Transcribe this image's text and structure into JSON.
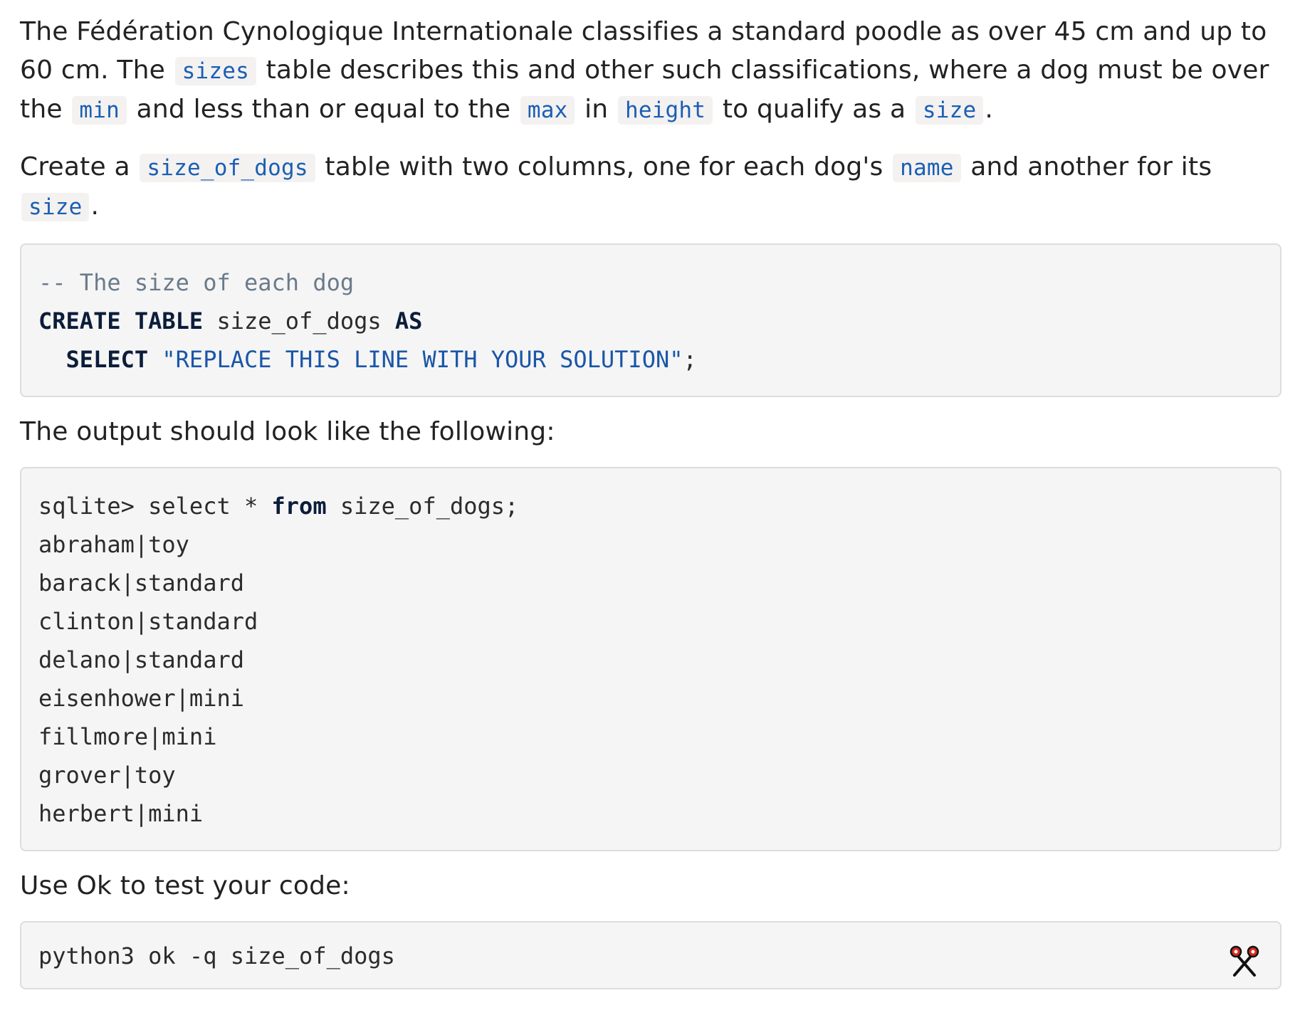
{
  "intro": {
    "t1": "The Fédération Cynologique Internationale classifies a standard poodle as over 45 cm and up to 60 cm. The",
    "c1": "sizes",
    "t2": "table describes this and other such classifications, where a dog must be over the",
    "c2": "min",
    "t3": "and less than or equal to the",
    "c3": "max",
    "t4": "in",
    "c4": "height",
    "t5": "to qualify as a",
    "c5": "size",
    "t6": "."
  },
  "task": {
    "t1": "Create a",
    "c1": "size_of_dogs",
    "t2": "table with two columns, one for each dog's",
    "c2": "name",
    "t3": "and another for its",
    "c3": "size",
    "t4": "."
  },
  "starter_code": {
    "comment": "-- The size of each dog",
    "line2_kw1": "CREATE TABLE",
    "line2_name": "size_of_dogs",
    "line2_kw2": "AS",
    "line3_indent": "  ",
    "line3_kw": "SELECT",
    "line3_str": "\"REPLACE THIS LINE WITH YOUR SOLUTION\"",
    "line3_end": ";"
  },
  "output_label": "The output should look like the following:",
  "output_code": {
    "prompt_pre": "sqlite> select * ",
    "prompt_kw": "from",
    "prompt_post": " size_of_dogs;",
    "rows": [
      "abraham|toy",
      "barack|standard",
      "clinton|standard",
      "delano|standard",
      "eisenhower|mini",
      "fillmore|mini",
      "grover|toy",
      "herbert|mini"
    ]
  },
  "test_label": "Use Ok to test your code:",
  "test_command": "python3 ok -q size_of_dogs",
  "colors": {
    "inline_code": "#1a5fb4",
    "inline_code_bg": "#f4f1f1",
    "code_bg": "#f5f5f5",
    "keyword": "#0b1d3a",
    "string": "#1a56a8",
    "comment": "#6b7a8a",
    "copy_icon_accent": "#d62a1e"
  },
  "icons": {
    "copy": "scissors-icon"
  }
}
